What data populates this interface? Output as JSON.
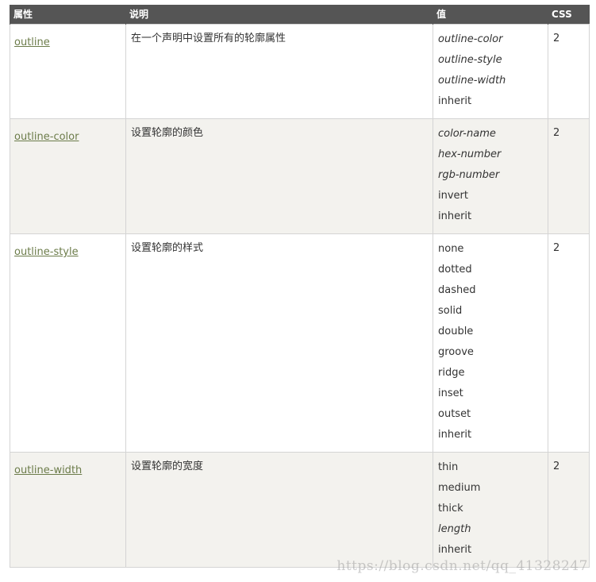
{
  "table": {
    "headers": [
      "属性",
      "说明",
      "值",
      "CSS"
    ],
    "rows": [
      {
        "property": "outline",
        "description": "在一个声明中设置所有的轮廓属性",
        "values": [
          {
            "text": "outline-color",
            "italic": true
          },
          {
            "text": "outline-style",
            "italic": true
          },
          {
            "text": "outline-width",
            "italic": true
          },
          {
            "text": "inherit",
            "italic": false
          }
        ],
        "css": "2"
      },
      {
        "property": "outline-color",
        "description": "设置轮廓的颜色",
        "values": [
          {
            "text": "color-name",
            "italic": true
          },
          {
            "text": "hex-number",
            "italic": true
          },
          {
            "text": "rgb-number",
            "italic": true
          },
          {
            "text": "invert",
            "italic": false
          },
          {
            "text": "inherit",
            "italic": false
          }
        ],
        "css": "2"
      },
      {
        "property": "outline-style",
        "description": "设置轮廓的样式",
        "values": [
          {
            "text": "none",
            "italic": false
          },
          {
            "text": "dotted",
            "italic": false
          },
          {
            "text": "dashed",
            "italic": false
          },
          {
            "text": "solid",
            "italic": false
          },
          {
            "text": "double",
            "italic": false
          },
          {
            "text": "groove",
            "italic": false
          },
          {
            "text": "ridge",
            "italic": false
          },
          {
            "text": "inset",
            "italic": false
          },
          {
            "text": "outset",
            "italic": false
          },
          {
            "text": "inherit",
            "italic": false
          }
        ],
        "css": "2"
      },
      {
        "property": "outline-width",
        "description": "设置轮廓的宽度",
        "values": [
          {
            "text": "thin",
            "italic": false
          },
          {
            "text": "medium",
            "italic": false
          },
          {
            "text": "thick",
            "italic": false
          },
          {
            "text": "length",
            "italic": true
          },
          {
            "text": "inherit",
            "italic": false
          }
        ],
        "css": "2"
      }
    ]
  },
  "watermark": "https://blog.csdn.net/qq_41328247",
  "colors": {
    "header_bg": "#555555",
    "link": "#6c7c4a",
    "alt_row_bg": "#f3f2ee",
    "border": "#d4d4d4"
  }
}
